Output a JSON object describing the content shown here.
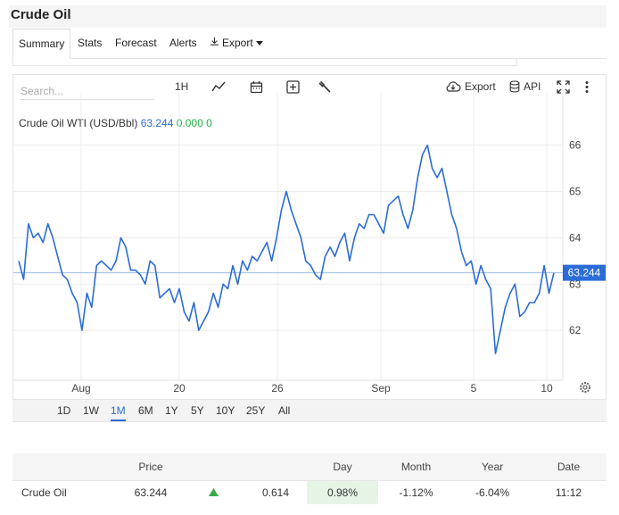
{
  "page": {
    "title": "Crude Oil"
  },
  "tabs": [
    {
      "label": "Summary"
    },
    {
      "label": "Stats"
    },
    {
      "label": "Forecast"
    },
    {
      "label": "Alerts"
    },
    {
      "label": "Export"
    }
  ],
  "toolbar": {
    "search_placeholder": "Search...",
    "interval": "1H",
    "export_label": "Export",
    "api_label": "API",
    "icons": [
      "line-chart-icon",
      "calendar-icon",
      "add-indicator-icon",
      "wrench-icon",
      "cloud-download-icon",
      "database-icon",
      "fullscreen-icon",
      "more-icon"
    ]
  },
  "series": {
    "name": "Crude Oil WTI (USD/Bbl)",
    "value": "63.244",
    "change": "0.000 0"
  },
  "colors": {
    "line": "#2b6cd6",
    "badge": "#2b6cd6",
    "positive": "#2f9e44"
  },
  "chart_data": {
    "type": "line",
    "x_ticks": [
      "Aug",
      "20",
      "26",
      "Sep",
      "5",
      "10"
    ],
    "y_ticks": [
      "62",
      "63",
      "64",
      "65",
      "66"
    ],
    "ylim": [
      61.0,
      66.9
    ],
    "current_value_label": "63.244",
    "values": [
      63.5,
      63.1,
      64.3,
      64.0,
      64.1,
      63.9,
      64.3,
      64.0,
      63.6,
      63.2,
      63.1,
      62.8,
      62.6,
      62.0,
      62.8,
      62.5,
      63.4,
      63.5,
      63.4,
      63.3,
      63.5,
      64.0,
      63.8,
      63.3,
      63.3,
      63.2,
      63.0,
      63.5,
      63.4,
      62.7,
      62.8,
      62.9,
      62.6,
      62.9,
      62.4,
      62.2,
      62.6,
      62.0,
      62.2,
      62.4,
      62.8,
      62.5,
      63.0,
      62.9,
      63.4,
      63.0,
      63.5,
      63.3,
      63.6,
      63.5,
      63.7,
      63.9,
      63.5,
      64.0,
      64.6,
      65.0,
      64.6,
      64.3,
      64.0,
      63.5,
      63.4,
      63.2,
      63.1,
      63.6,
      63.8,
      63.6,
      63.9,
      64.1,
      63.5,
      64.0,
      64.3,
      64.2,
      64.5,
      64.5,
      64.3,
      64.1,
      64.7,
      64.8,
      64.9,
      64.5,
      64.2,
      64.6,
      65.3,
      65.8,
      66.0,
      65.5,
      65.3,
      65.5,
      65.0,
      64.5,
      64.2,
      63.7,
      63.4,
      63.5,
      63.0,
      63.4,
      63.1,
      62.9,
      61.5,
      62.0,
      62.5,
      62.8,
      63.0,
      62.3,
      62.4,
      62.6,
      62.6,
      62.8,
      63.4,
      62.8,
      63.244
    ]
  },
  "range_buttons": [
    "1D",
    "1W",
    "1M",
    "6M",
    "1Y",
    "5Y",
    "10Y",
    "25Y",
    "All"
  ],
  "range_active": "1M",
  "quote_table": {
    "headers": [
      "",
      "Price",
      "",
      "",
      "Day",
      "Month",
      "Year",
      "Date"
    ],
    "row": {
      "name": "Crude Oil",
      "price": "63.244",
      "change": "0.614",
      "day": "0.98%",
      "month": "-1.12%",
      "year": "-6.04%",
      "date": "11:12"
    }
  }
}
